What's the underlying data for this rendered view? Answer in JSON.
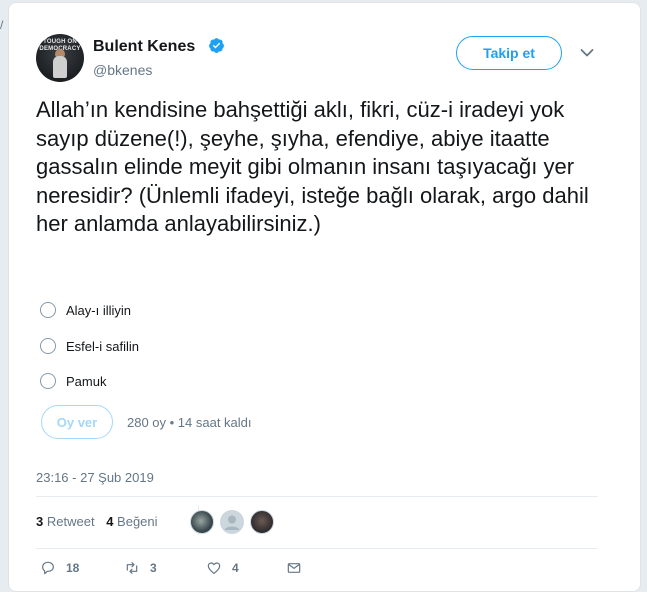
{
  "corner_char": "/",
  "author": {
    "display_name": "Bulent Kenes",
    "handle": "@bkenes",
    "avatar_text": "TOUGH ON DEMOCRACY"
  },
  "follow_label": "Takip et",
  "tweet_text": "Allah’ın kendisine bahşettiği aklı, fikri, cüz-i iradeyi yok sayıp düzene(!), şeyhe, şıyha, efendiye, abiye itaatte gassalın elinde meyit gibi olmanın insanı taşıyacağı yer neresidir? (Ünlemli ifadeyi, isteğe bağlı olarak, argo dahil her anlamda anlayabilirsiniz.)",
  "poll": {
    "options": [
      "Alay-ı illiyin",
      "Esfel-i safilin",
      "Pamuk"
    ],
    "vote_label": "Oy ver",
    "meta": "280 oy • 14 saat kaldı"
  },
  "timestamp": "23:16 - 27 Şub 2019",
  "stats": {
    "retweet_count": "3",
    "retweet_label": "Retweet",
    "like_count": "4",
    "like_label": "Beğeni"
  },
  "actions": {
    "reply_count": "18",
    "retweet_count": "3",
    "like_count": "4"
  },
  "colors": {
    "accent": "#1da1f2",
    "muted": "#657786",
    "text": "#14171a"
  }
}
